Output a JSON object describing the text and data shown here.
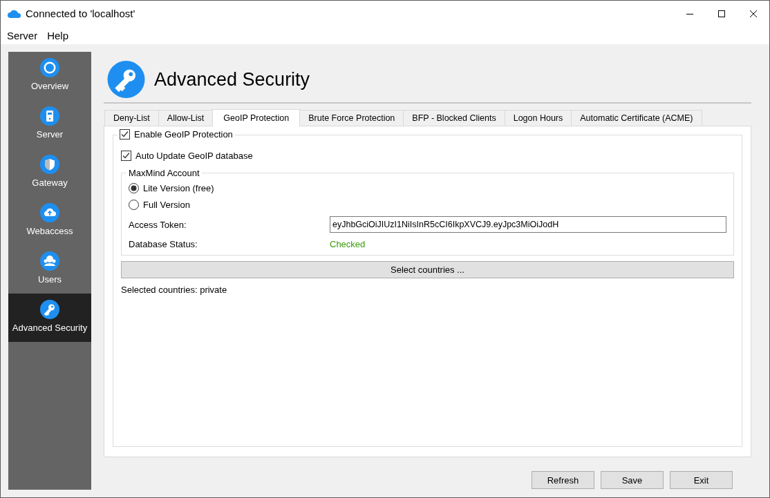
{
  "window": {
    "title": "Connected to 'localhost'"
  },
  "menu": [
    {
      "label": "Server"
    },
    {
      "label": "Help"
    }
  ],
  "sidebar": {
    "items": [
      {
        "label": "Overview",
        "kind": "overview",
        "selected": false
      },
      {
        "label": "Server",
        "kind": "server",
        "selected": false
      },
      {
        "label": "Gateway",
        "kind": "gateway",
        "selected": false
      },
      {
        "label": "Webaccess",
        "kind": "webaccess",
        "selected": false
      },
      {
        "label": "Users",
        "kind": "users",
        "selected": false
      },
      {
        "label": "Advanced Security",
        "kind": "security",
        "selected": true
      }
    ]
  },
  "page": {
    "title": "Advanced Security"
  },
  "tabs": [
    {
      "label": "Deny-List",
      "selected": false
    },
    {
      "label": "Allow-List",
      "selected": false
    },
    {
      "label": "GeoIP Protection",
      "selected": true
    },
    {
      "label": "Brute Force Protection",
      "selected": false
    },
    {
      "label": "BFP - Blocked Clients",
      "selected": false
    },
    {
      "label": "Logon Hours",
      "selected": false
    },
    {
      "label": "Automatic Certificate (ACME)",
      "selected": false
    }
  ],
  "geoip": {
    "enable": {
      "label": "Enable GeoIP Protection",
      "checked": true
    },
    "auto_update": {
      "label": "Auto Update GeoIP database",
      "checked": true
    },
    "account": {
      "legend": "MaxMind Account",
      "options": [
        {
          "label": "Lite Version (free)",
          "selected": true
        },
        {
          "label": "Full Version",
          "selected": false
        }
      ],
      "access_token": {
        "label": "Access Token:",
        "value": "eyJhbGciOiJIUzI1NiIsInR5cCI6IkpXVCJ9.eyJpc3MiOiJodH"
      },
      "database_status": {
        "label": "Database Status:",
        "value": "Checked"
      }
    },
    "select_button": "Select countries ...",
    "selected_countries": "Selected countries: private"
  },
  "buttons": [
    "Refresh",
    "Save",
    "Exit"
  ]
}
